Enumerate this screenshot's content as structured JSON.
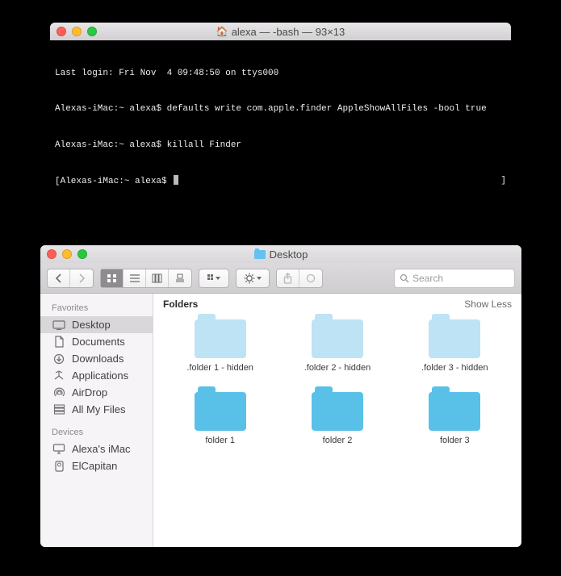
{
  "terminal": {
    "title": "alexa — -bash — 93×13",
    "lines": {
      "l0": "Last login: Fri Nov  4 09:48:50 on ttys000",
      "l1": "Alexas-iMac:~ alexa$ defaults write com.apple.finder AppleShowAllFiles -bool true",
      "l2": "Alexas-iMac:~ alexa$ killall Finder",
      "l3_open": "[Alexas-iMac:~ alexa$",
      "l3_close": "]"
    }
  },
  "finder": {
    "title": "Desktop",
    "toolbar": {
      "search_placeholder": "Search"
    },
    "sidebar": {
      "section1_label": "Favorites",
      "items1": {
        "desktop": "Desktop",
        "documents": "Documents",
        "downloads": "Downloads",
        "applications": "Applications",
        "airdrop": "AirDrop",
        "allmyfiles": "All My Files"
      },
      "section2_label": "Devices",
      "items2": {
        "imac": "Alexa's iMac",
        "elcapitan": "ElCapitan"
      }
    },
    "content": {
      "section_label": "Folders",
      "show_less": "Show Less",
      "folders": {
        "h1": ".folder 1 - hidden",
        "h2": ".folder 2 - hidden",
        "h3": ".folder 3 - hidden",
        "n1": "folder 1",
        "n2": "folder 2",
        "n3": "folder 3"
      }
    }
  }
}
